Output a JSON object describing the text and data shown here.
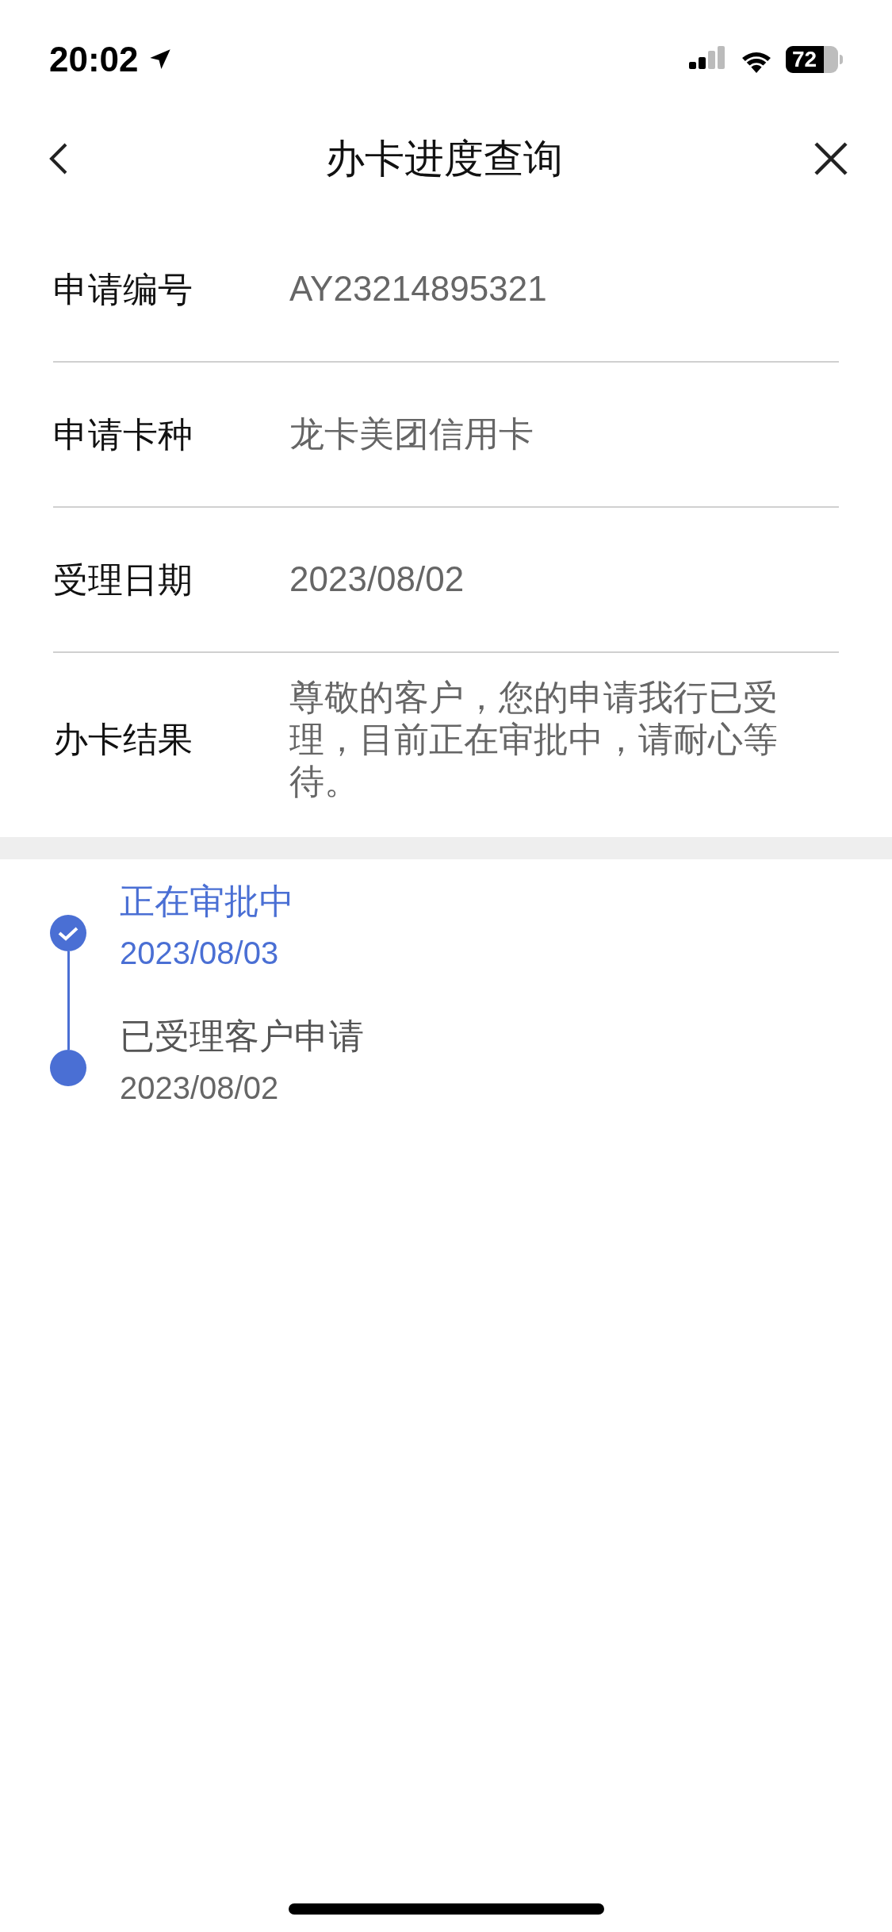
{
  "status_bar": {
    "time": "20:02",
    "battery": "72"
  },
  "nav": {
    "title": "办卡进度查询"
  },
  "details": [
    {
      "label": "申请编号",
      "value": "AY23214895321"
    },
    {
      "label": "申请卡种",
      "value": "龙卡美团信用卡"
    },
    {
      "label": "受理日期",
      "value": "2023/08/02"
    },
    {
      "label": "办卡结果",
      "value": "尊敬的客户，您的申请我行已受理，目前正在审批中，请耐心等待。"
    }
  ],
  "timeline": [
    {
      "title": "正在审批中",
      "date": "2023/08/03",
      "current": true
    },
    {
      "title": "已受理客户申请",
      "date": "2023/08/02",
      "current": false
    }
  ]
}
